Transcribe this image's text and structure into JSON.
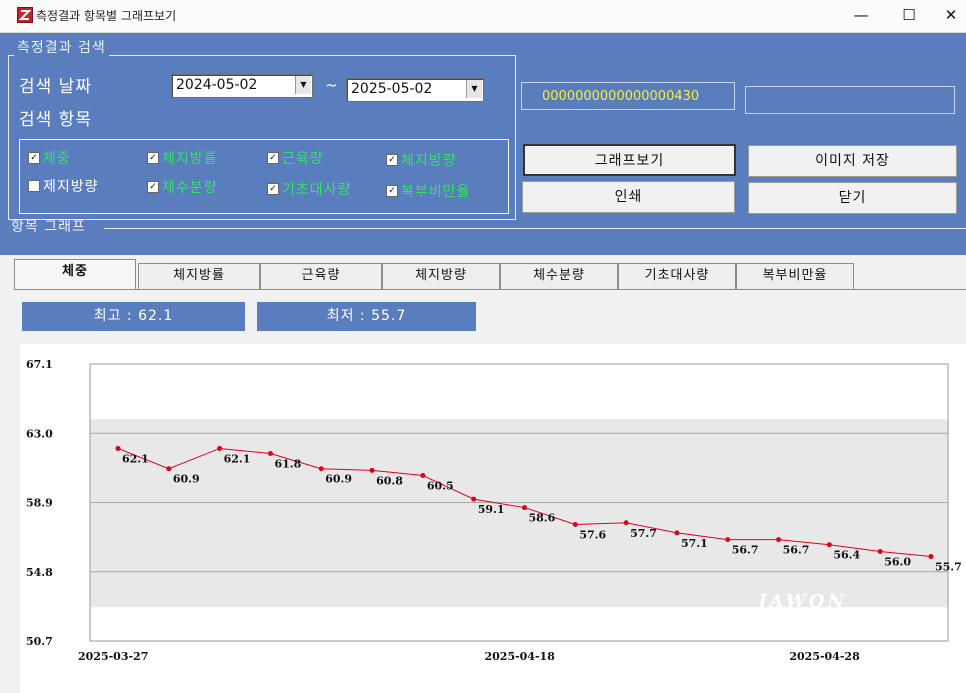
{
  "window": {
    "title": "측정결과 항목별 그래프보기",
    "controls": {
      "minimize": "—",
      "maximize": "☐",
      "close": "✕"
    }
  },
  "search": {
    "group_title": "측정결과 검색",
    "date_label": "검색 날짜",
    "date_from": "2024-05-02",
    "date_sep": "~",
    "date_to": "2025-05-02",
    "items_label": "검색 항목",
    "checkboxes": [
      {
        "label": "체중",
        "checked": true
      },
      {
        "label": "체지방률",
        "checked": true
      },
      {
        "label": "근육량",
        "checked": true
      },
      {
        "label": "체지방량",
        "checked": true
      },
      {
        "label": "제지방량",
        "checked": false
      },
      {
        "label": "체수분량",
        "checked": true
      },
      {
        "label": "기초대사량",
        "checked": true
      },
      {
        "label": "복부비만율",
        "checked": true
      }
    ]
  },
  "member_id": "0000000000000000430",
  "member_name": "",
  "buttons": {
    "graph": "그래프보기",
    "save_image": "이미지 저장",
    "print": "인쇄",
    "close": "닫기"
  },
  "graph": {
    "group_title": "항목 그래프",
    "tabs": [
      "체중",
      "체지방률",
      "근육량",
      "체지방량",
      "체수분량",
      "기초대사량",
      "복부비만율"
    ],
    "active_tab": "체중",
    "max_text": "최고 : 62.1",
    "min_text": "최저 : 55.7"
  },
  "chart_data": {
    "type": "line",
    "title": "",
    "xlabel": "",
    "ylabel": "",
    "ylim": [
      50.7,
      67.1
    ],
    "yticks": [
      "67.1",
      "63.0",
      "58.9",
      "54.8",
      "50.7"
    ],
    "xticks": [
      "2025-03-27",
      "2025-04-18",
      "2025-04-28"
    ],
    "watermark": "JAWON",
    "series": [
      {
        "values": [
          62.1,
          60.9,
          62.1,
          61.8,
          60.9,
          60.8,
          60.5,
          59.1,
          58.6,
          57.6,
          57.7,
          57.1,
          56.7,
          56.7,
          56.4,
          56.0,
          55.7
        ],
        "labels": [
          "62.1",
          "60.9",
          "62.1",
          "61.8",
          "60.9",
          "60.8",
          "60.5",
          "59.1",
          "58.6",
          "57.6",
          "57.7",
          "57.1",
          "56.7",
          "56.7",
          "56.4",
          "56.0",
          "55.7"
        ]
      }
    ],
    "line_color": "#e0001c",
    "grid": true
  }
}
